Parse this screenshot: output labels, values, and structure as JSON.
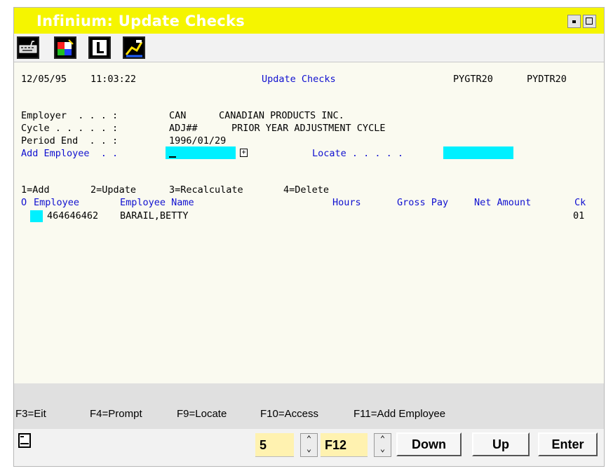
{
  "window": {
    "title": "Infinium: Update Checks",
    "title_color": "#ffffff",
    "titlebar_color": "#f5f500"
  },
  "toolbar": {
    "icons": [
      "keyboard-icon",
      "color-palette-icon",
      "info-icon",
      "edit-icon"
    ]
  },
  "header": {
    "date": "12/05/95",
    "time": "11:03:22",
    "screen_title": "Update Checks",
    "program1": "PYGTR20",
    "program2": "PYDTR20"
  },
  "fields": {
    "employer_label": "Employer  . . . :",
    "employer_code": "CAN",
    "employer_name": "CANADIAN PRODUCTS INC.",
    "cycle_label": "Cycle . . . . . :",
    "cycle_code": "ADJ##",
    "cycle_name": "PRIOR YEAR ADJUSTMENT CYCLE",
    "period_label": "Period End  . . :",
    "period_value": "1996/01/29",
    "add_employee_label": "Add Employee  . .",
    "add_employee_value": "",
    "prompt_symbol": "+",
    "locate_label": "Locate . . . . .",
    "locate_value": ""
  },
  "options": {
    "add": "1=Add",
    "update": "2=Update",
    "recalculate": "3=Recalculate",
    "delete": "4=Delete"
  },
  "table": {
    "columns": {
      "opt": "O",
      "employee": "Employee",
      "name": "Employee Name",
      "hours": "Hours",
      "gross_pay": "Gross Pay",
      "net_amount": "Net Amount",
      "ck": "Ck"
    },
    "rows": [
      {
        "opt": "",
        "employee": "464646462",
        "name": "BARAIL,BETTY",
        "hours": "",
        "gross_pay": "",
        "net_amount": "",
        "ck": "01"
      }
    ]
  },
  "function_keys": {
    "f3": "F3=Eit",
    "f4": "F4=Prompt",
    "f9": "F9=Locate",
    "f10": "F10=Access",
    "f11": "F11=Add Employee"
  },
  "bottom": {
    "page_value": "5",
    "fkey_value": "F12",
    "down_label": "Down",
    "up_label": "Up",
    "enter_label": "Enter"
  },
  "colors": {
    "input_field": "#00f0ff",
    "label_blue": "#1010d0",
    "numbox": "#fff2b0"
  }
}
